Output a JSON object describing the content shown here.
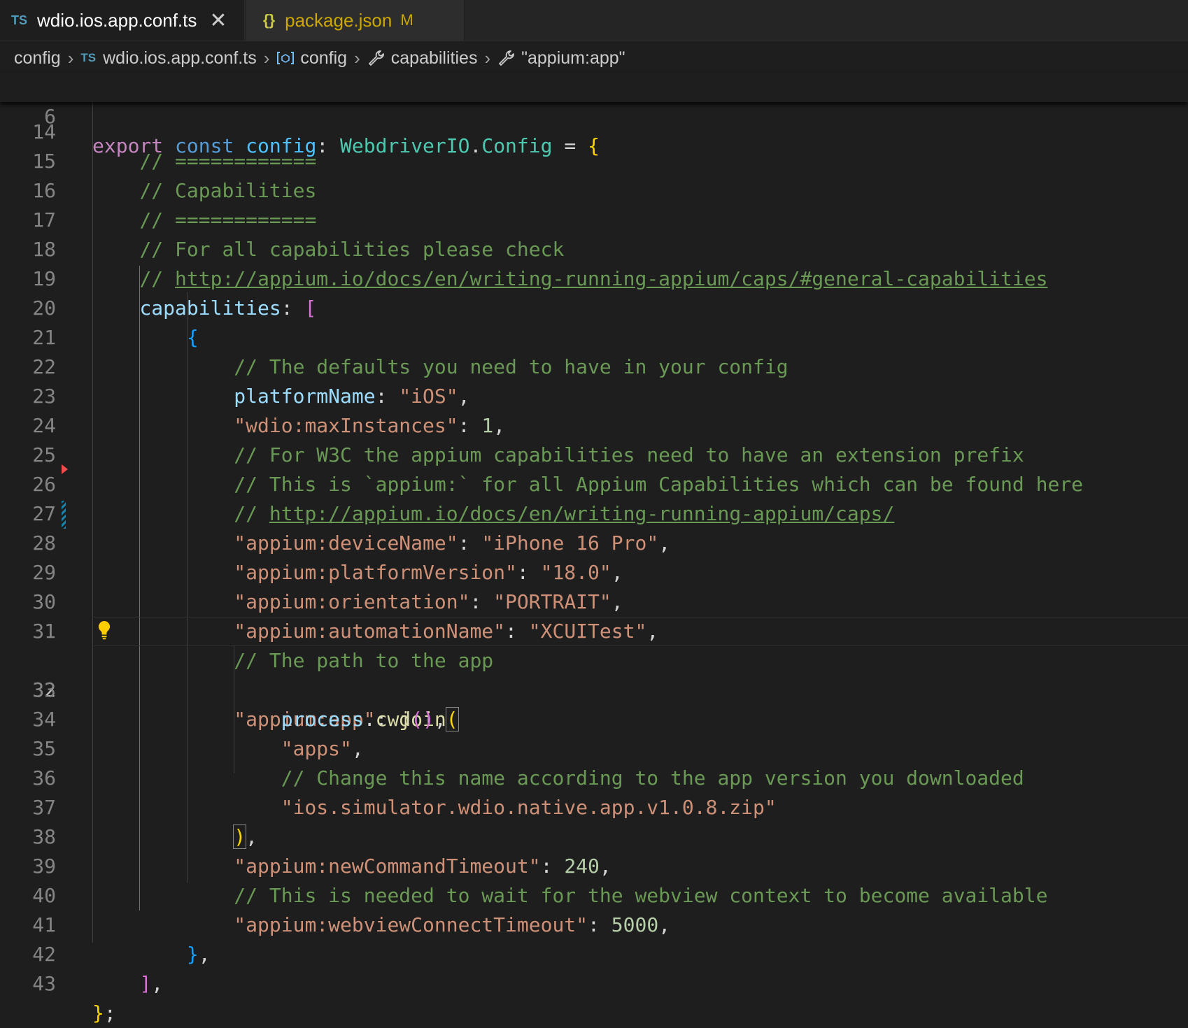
{
  "tabs": [
    {
      "badge": "TS",
      "label": "wdio.ios.app.conf.ts",
      "close": "✕"
    },
    {
      "badge": "{}",
      "label": "package.json",
      "status": "M"
    }
  ],
  "breadcrumb": {
    "items": [
      "config",
      "wdio.ios.app.conf.ts",
      "config",
      "capabilities",
      "\"appium:app\""
    ],
    "ts_badge": "TS",
    "icons": [
      "file-ts-icon",
      "variable-icon",
      "wrench-icon",
      "wrench-icon"
    ]
  },
  "editor": {
    "sticky": {
      "ln": "6",
      "kw_export": "export",
      "kw_const": "const",
      "name": "config",
      "colon": ": ",
      "type1": "WebdriverIO",
      "dot": ".",
      "type2": "Config",
      "eq": " = ",
      "brace": "{"
    },
    "lines": [
      {
        "ln": "14",
        "indent": "    ",
        "comment": "// ============"
      },
      {
        "ln": "15",
        "indent": "    ",
        "comment": "// Capabilities"
      },
      {
        "ln": "16",
        "indent": "    ",
        "comment": "// ============"
      },
      {
        "ln": "17",
        "indent": "    ",
        "comment": "// For all capabilities please check"
      },
      {
        "ln": "18",
        "indent": "    ",
        "prefix": "// ",
        "link": "http://appium.io/docs/en/writing-running-appium/caps/#general-capabilities"
      },
      {
        "ln": "19",
        "indent": "    ",
        "prop": "capabilities",
        "colon": ": ",
        "open": "["
      },
      {
        "ln": "20",
        "indent": "        ",
        "open": "{"
      },
      {
        "ln": "21",
        "indent": "            ",
        "comment": "// The defaults you need to have in your config"
      },
      {
        "ln": "22",
        "indent": "            ",
        "prop": "platformName",
        "colon": ": ",
        "val": "\"iOS\"",
        "tail": ","
      },
      {
        "ln": "23",
        "indent": "            ",
        "key": "\"wdio:maxInstances\"",
        "colon": ": ",
        "num": "1",
        "tail": ","
      },
      {
        "ln": "24",
        "indent": "            ",
        "comment": "// For W3C the appium capabilities need to have an extension prefix"
      },
      {
        "ln": "25",
        "indent": "            ",
        "comment": "// This is `appium:` for all Appium Capabilities which can be found here"
      },
      {
        "ln": "26",
        "indent": "            ",
        "prefix": "// ",
        "link": "http://appium.io/docs/en/writing-running-appium/caps/"
      },
      {
        "ln": "27",
        "indent": "            ",
        "key": "\"appium:deviceName\"",
        "colon": ": ",
        "val": "\"iPhone 16 Pro\"",
        "tail": ","
      },
      {
        "ln": "28",
        "indent": "            ",
        "key": "\"appium:platformVersion\"",
        "colon": ": ",
        "val": "\"18.0\"",
        "tail": ","
      },
      {
        "ln": "29",
        "indent": "            ",
        "key": "\"appium:orientation\"",
        "colon": ": ",
        "val": "\"PORTRAIT\"",
        "tail": ","
      },
      {
        "ln": "30",
        "indent": "            ",
        "key": "\"appium:automationName\"",
        "colon": ": ",
        "val": "\"XCUITest\"",
        "tail": ","
      },
      {
        "ln": "31",
        "indent": "            ",
        "comment": "// The path to the app"
      },
      {
        "ln": "32",
        "indent": "            ",
        "key": "\"appium:app\"",
        "colon": ": ",
        "fn": "join",
        "open": "("
      },
      {
        "ln": "33",
        "indent": "                ",
        "obj": "process",
        "dot": ".",
        "fn": "cwd",
        "parens": "()",
        "tail": ","
      },
      {
        "ln": "34",
        "indent": "                ",
        "val": "\"apps\"",
        "tail": ","
      },
      {
        "ln": "35",
        "indent": "                ",
        "comment": "// Change this name according to the app version you downloaded"
      },
      {
        "ln": "36",
        "indent": "                ",
        "val": "\"ios.simulator.wdio.native.app.v1.0.8.zip\""
      },
      {
        "ln": "37",
        "indent": "            ",
        "close": ")",
        "tail": ","
      },
      {
        "ln": "38",
        "indent": "            ",
        "key": "\"appium:newCommandTimeout\"",
        "colon": ": ",
        "num": "240",
        "tail": ","
      },
      {
        "ln": "39",
        "indent": "            ",
        "comment": "// This is needed to wait for the webview context to become available"
      },
      {
        "ln": "40",
        "indent": "            ",
        "key": "\"appium:webviewConnectTimeout\"",
        "colon": ": ",
        "num": "5000",
        "tail": ","
      },
      {
        "ln": "41",
        "indent": "        ",
        "close": "}",
        "tail": ","
      },
      {
        "ln": "42",
        "indent": "    ",
        "close": "]",
        "tail": ","
      },
      {
        "ln": "43",
        "indent": "",
        "close": "}",
        "tail": ";"
      }
    ]
  }
}
